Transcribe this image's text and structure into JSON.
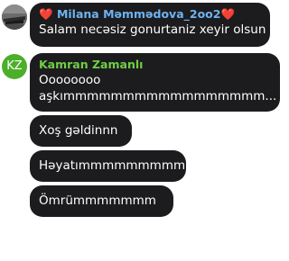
{
  "messages": [
    {
      "sender": "Milana Məmmədova_2oo2",
      "sender_prefix": "❤️",
      "sender_suffix": "❤️",
      "sender_color": "#6db3f2",
      "avatar_type": "photo",
      "text": "Salam necəsiz gonurtaniz xeyir olsun"
    },
    {
      "sender": "Kamran Zamanlı",
      "sender_color": "#6fcf44",
      "avatar_type": "initials",
      "avatar_initials": "KZ",
      "avatar_color": "#4caf2a",
      "text_line1": "Oooooooo",
      "text_line2": "aşkımmmmmmmmmmmmmmmmm..."
    },
    {
      "text": "Xoş gəldinnn"
    },
    {
      "text": "Həyatımmmmmmmmm"
    },
    {
      "text": "Ömrümmmmmmm"
    }
  ],
  "colors": {
    "bubble": "#1c1c1e",
    "background": "#ffffff",
    "heart": "#e3253f"
  }
}
